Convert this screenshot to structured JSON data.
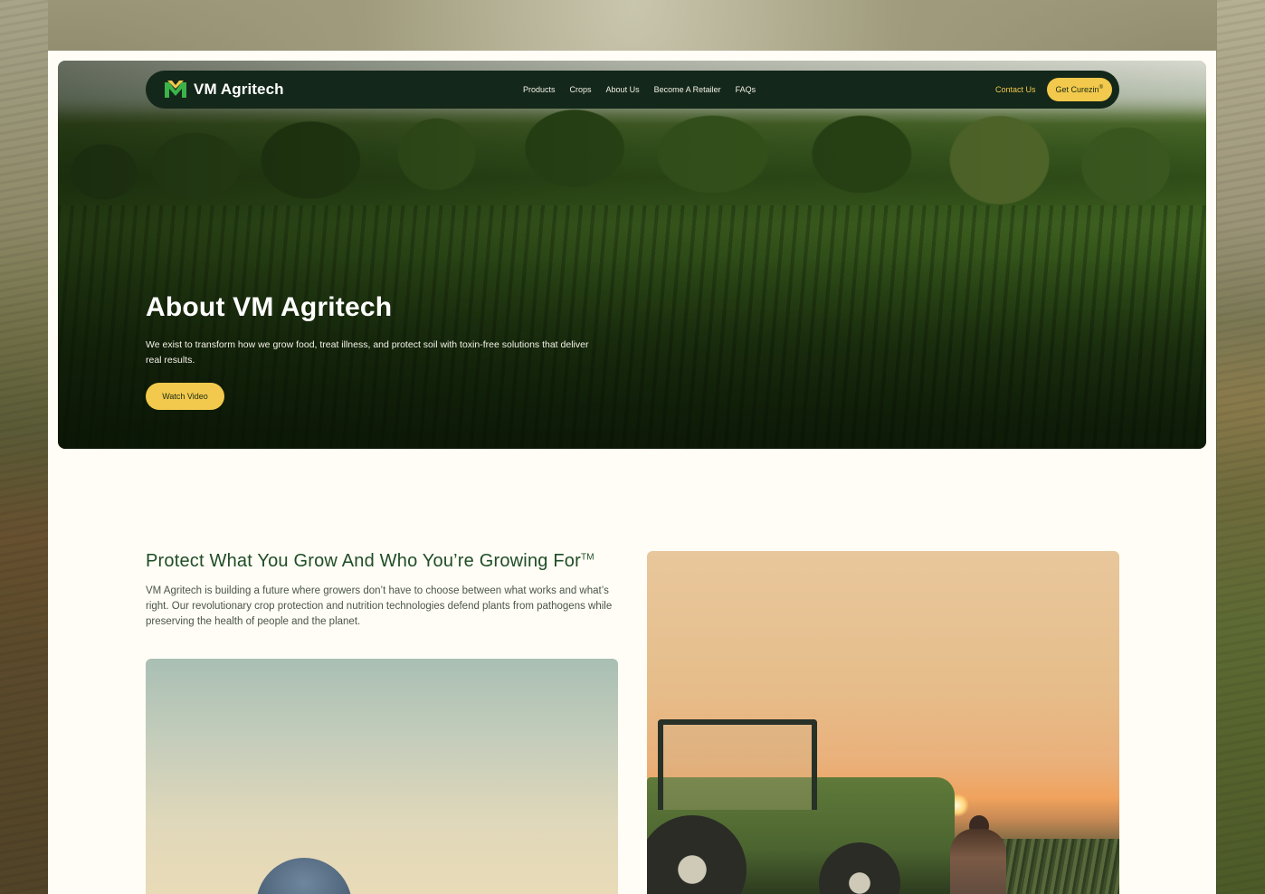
{
  "brand": {
    "name": "VM Agritech",
    "accent": "#f2c94c",
    "dark": "#13271a",
    "heading_green": "#1f4d26"
  },
  "nav": {
    "links": [
      "Products",
      "Crops",
      "About Us",
      "Become A Retailer",
      "FAQs"
    ],
    "contact_label": "Contact Us",
    "cta_label": "Get Curezin",
    "cta_mark": "®"
  },
  "hero": {
    "title": "About VM Agritech",
    "description": "We exist to transform how we grow food, treat illness, and protect soil with toxin-free solutions that deliver real results.",
    "button_label": "Watch Video"
  },
  "section": {
    "title": "Protect What You Grow And Who You’re Growing For",
    "title_mark": "TM",
    "text": "VM Agritech is building a future where growers don’t have to choose between what works and what’s right. Our revolutionary crop protection and nutrition technologies defend plants from pathogens while preserving the health of people and the planet."
  },
  "icons": {
    "logo": "vm-logo-mark-icon"
  }
}
